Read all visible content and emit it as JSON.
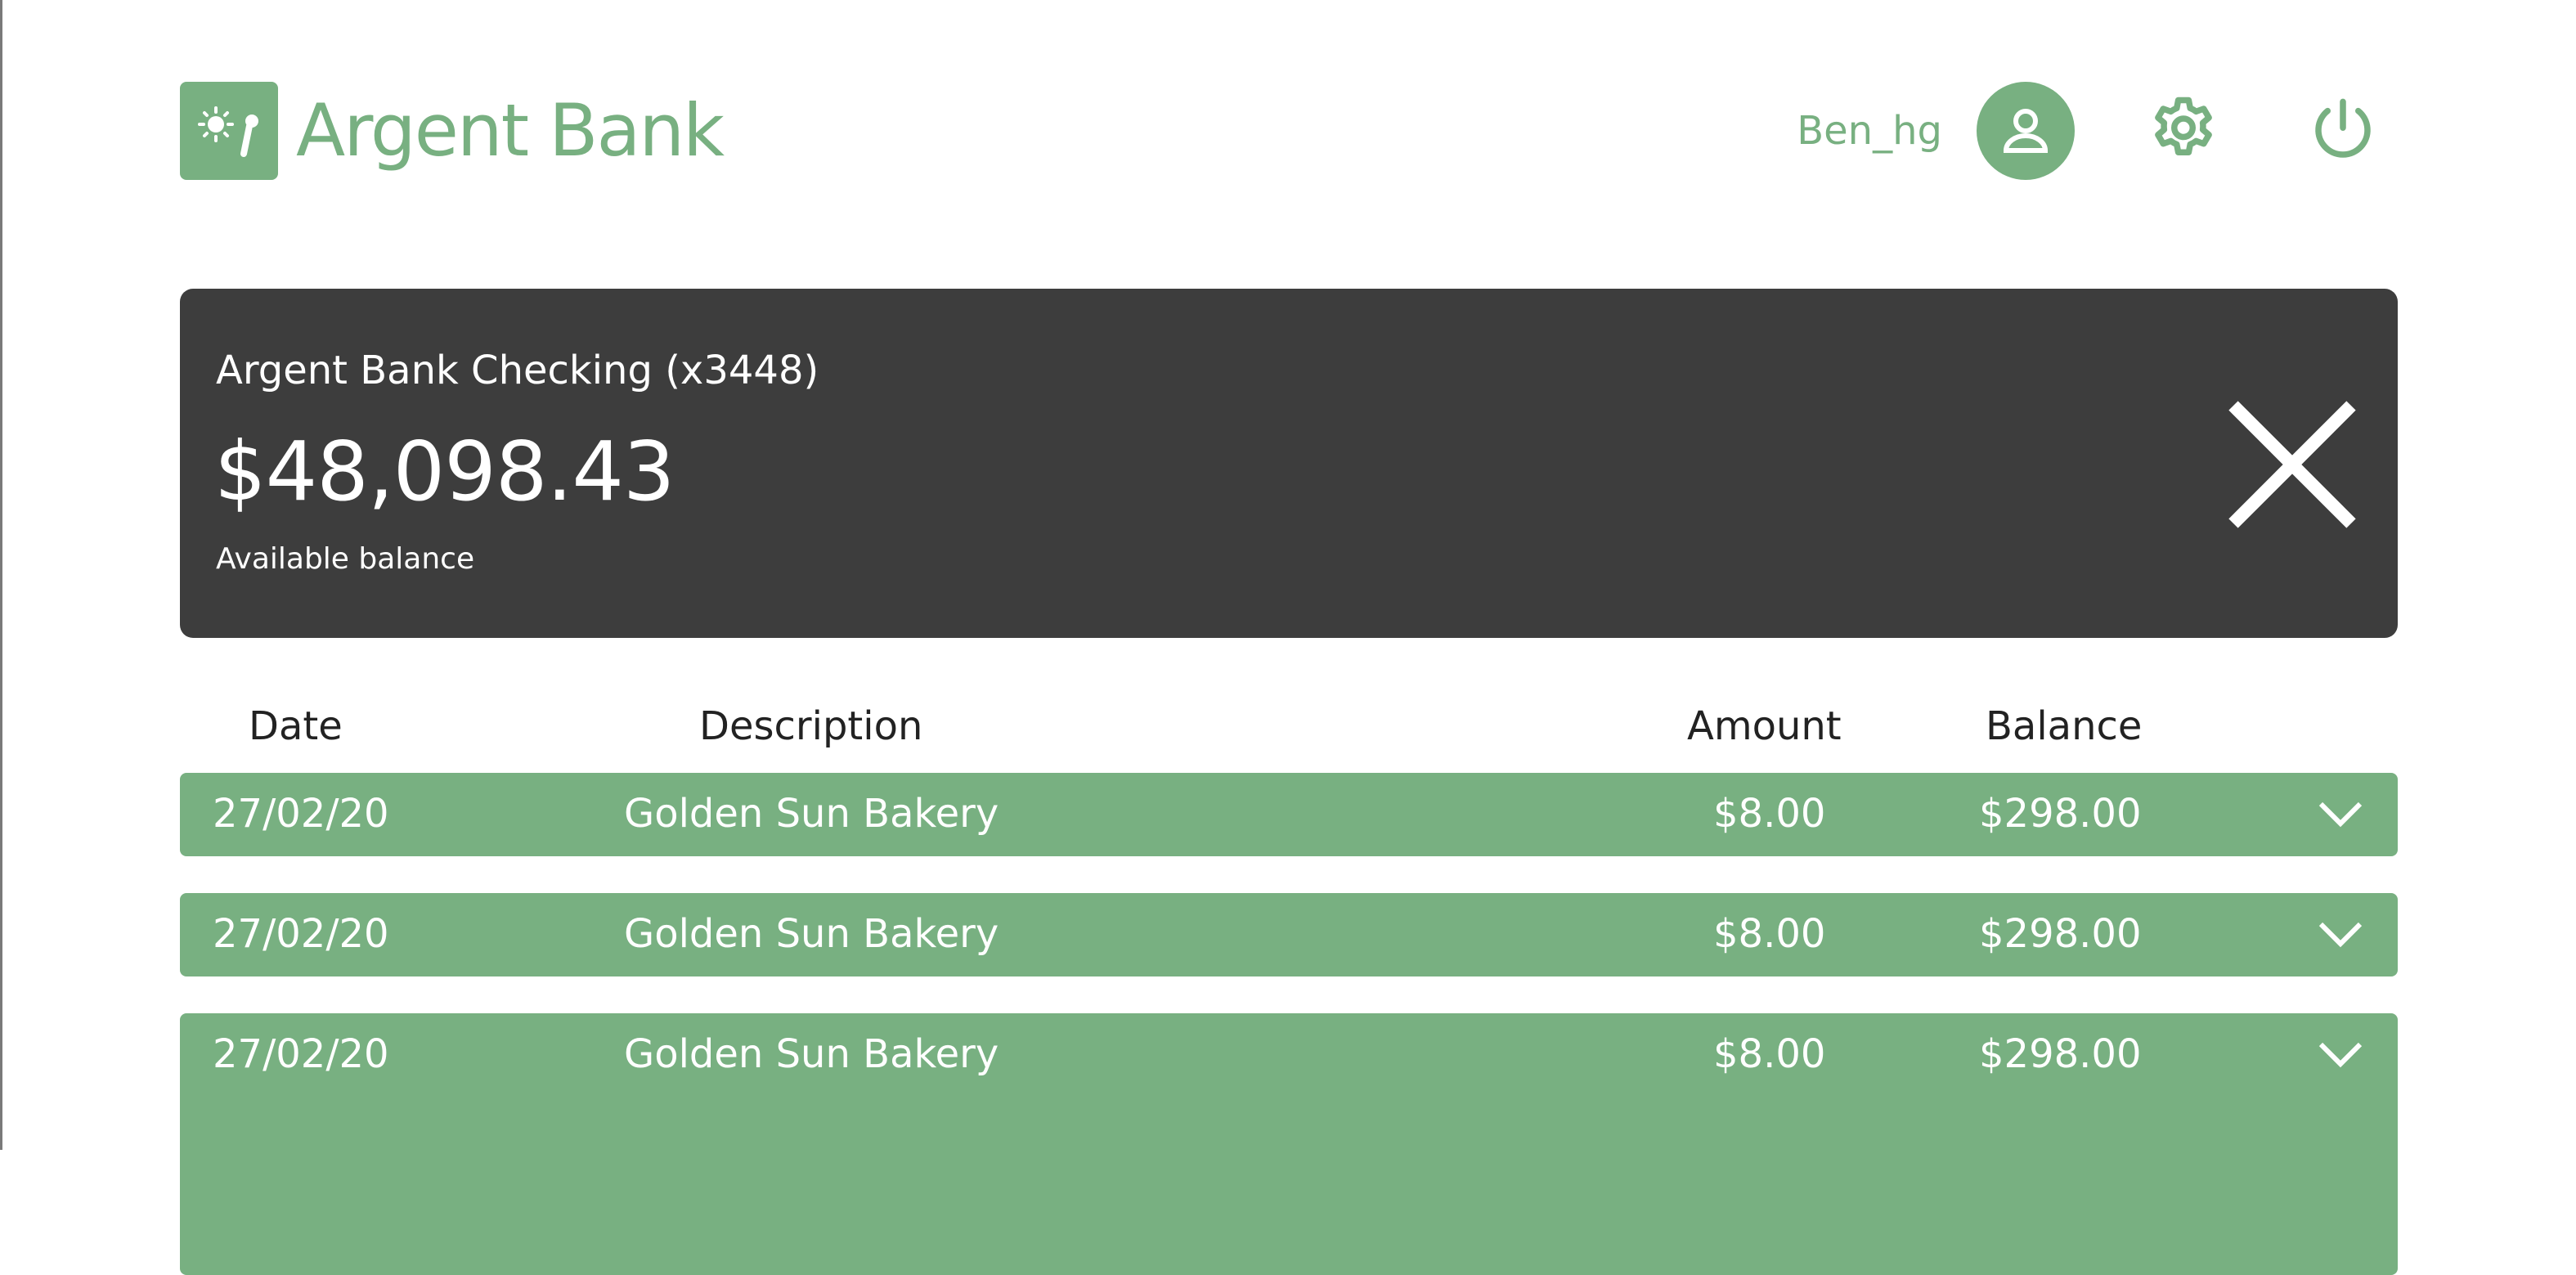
{
  "brand": {
    "name": "Argent Bank",
    "accent_color": "#78b081",
    "logo_icon": "bank-logo-icon"
  },
  "header": {
    "username": "Ben_hg",
    "profile_icon": "user-icon",
    "settings_icon": "gear-icon",
    "logout_icon": "power-icon"
  },
  "account": {
    "name": "Argent Bank Checking (x3448)",
    "balance": "$48,098.43",
    "balance_label": "Available balance",
    "close_icon": "close-icon",
    "card_color": "#3d3d3d"
  },
  "transactions": {
    "columns": [
      "Date",
      "Description",
      "Amount",
      "Balance"
    ],
    "rows": [
      {
        "date": "27/02/20",
        "description": "Golden Sun Bakery",
        "amount": "$8.00",
        "balance": "$298.00",
        "expanded": false
      },
      {
        "date": "27/02/20",
        "description": "Golden Sun Bakery",
        "amount": "$8.00",
        "balance": "$298.00",
        "expanded": false
      },
      {
        "date": "27/02/20",
        "description": "Golden Sun Bakery",
        "amount": "$8.00",
        "balance": "$298.00",
        "expanded": true
      }
    ],
    "expand_icon": "chevron-down-icon"
  }
}
